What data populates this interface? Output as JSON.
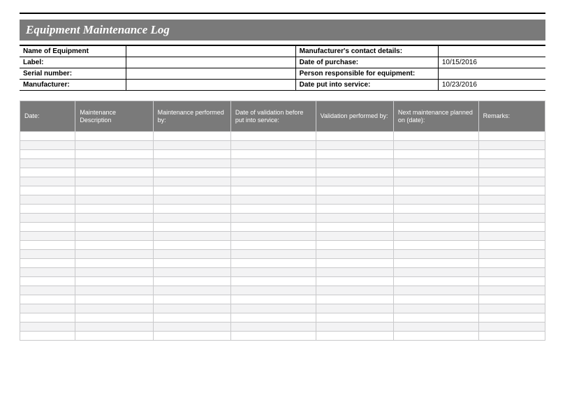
{
  "title": "Equipment Maintenance Log",
  "info": {
    "row1": {
      "l": "Name of Equipment",
      "v1": "",
      "r": "Manufacturer's contact details:",
      "v2": ""
    },
    "row2": {
      "l": "Label:",
      "v1": "",
      "r": "Date of purchase:",
      "v2": "10/15/2016"
    },
    "row3": {
      "l": "Serial number:",
      "v1": "",
      "r": "Person responsible for equipment:",
      "v2": ""
    },
    "row4": {
      "l": "Manufacturer:",
      "v1": "",
      "r": "Date put into service:",
      "v2": "10/23/2016"
    }
  },
  "columns": [
    "Date:",
    "Maintenance Description",
    "Maintenance performed by:",
    "Date of validation before put into service:",
    "Validation performed by:",
    "Next maintenance planned on (date):",
    "Remarks:"
  ],
  "row_count": 23
}
